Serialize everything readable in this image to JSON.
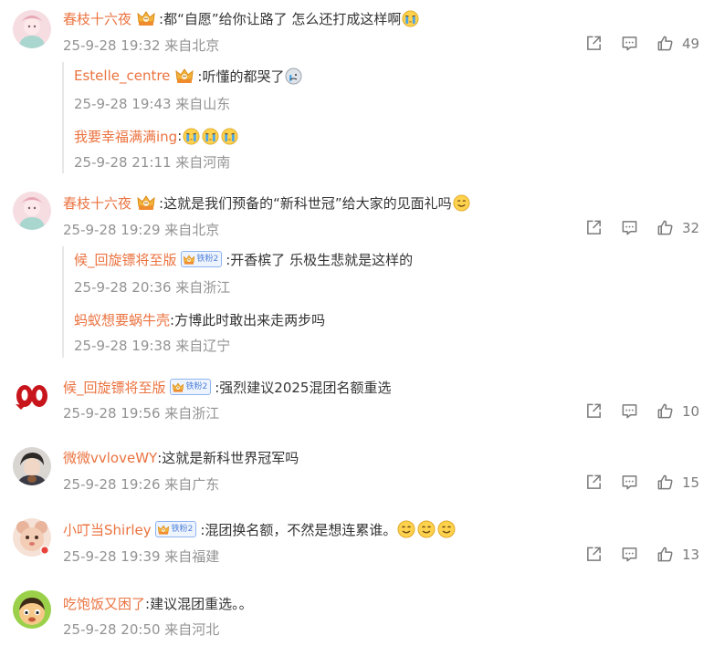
{
  "comments": [
    {
      "user": "春枝十六夜",
      "text_parts": [
        ":都“自愿”给你让路了 怎么还打成这样啊"
      ],
      "meta": "25-9-28 19:32 来自北京",
      "likes": "49",
      "replies": [
        {
          "user": "Estelle_centre",
          "text": ":听懂的都哭了",
          "meta": "25-9-28 19:43 来自山东"
        },
        {
          "user": "我要幸福满满ing",
          "text": ":",
          "meta": "25-9-28 21:11 来自河南"
        }
      ]
    },
    {
      "user": "春枝十六夜",
      "text_parts": [
        ":这就是我们预备的“新科世冠”给大家的见面礼吗"
      ],
      "meta": "25-9-28 19:29 来自北京",
      "likes": "32",
      "replies": [
        {
          "user": "候_回旋镖将至版",
          "badge": "铁粉2",
          "text": ":开香槟了 乐极生悲就是这样的",
          "meta": "25-9-28 20:36 来自浙江"
        },
        {
          "user": "蚂蚁想要蜗牛壳",
          "text": ":方博此时敢出来走两步吗",
          "meta": "25-9-28 19:38 来自辽宁"
        }
      ]
    },
    {
      "user": "候_回旋镖将至版",
      "badge": "铁粉2",
      "text": ":强烈建议2025混团名额重选",
      "meta": "25-9-28 19:56 来自浙江",
      "likes": "10"
    },
    {
      "user": "微微vvloveWY",
      "text": ":这就是新科世界冠军吗",
      "meta": "25-9-28 19:26 来自广东",
      "likes": "15"
    },
    {
      "user": "小叮当Shirley",
      "badge": "铁粉2",
      "text": ":混团换名额，不然是想连累谁。",
      "meta": "25-9-28 19:39 来自福建",
      "likes": "13"
    },
    {
      "user": "吃饱饭又困了",
      "text": ":建议混团重选。。",
      "meta": "25-9-28 20:50 来自河北"
    }
  ],
  "icons": {
    "share": "share-icon",
    "comment": "comment-icon",
    "like": "like-icon",
    "crown": "fan-crown-icon"
  },
  "colors": {
    "username": "#eb7340",
    "meta": "#939393",
    "badge": "#4d7fd8"
  }
}
